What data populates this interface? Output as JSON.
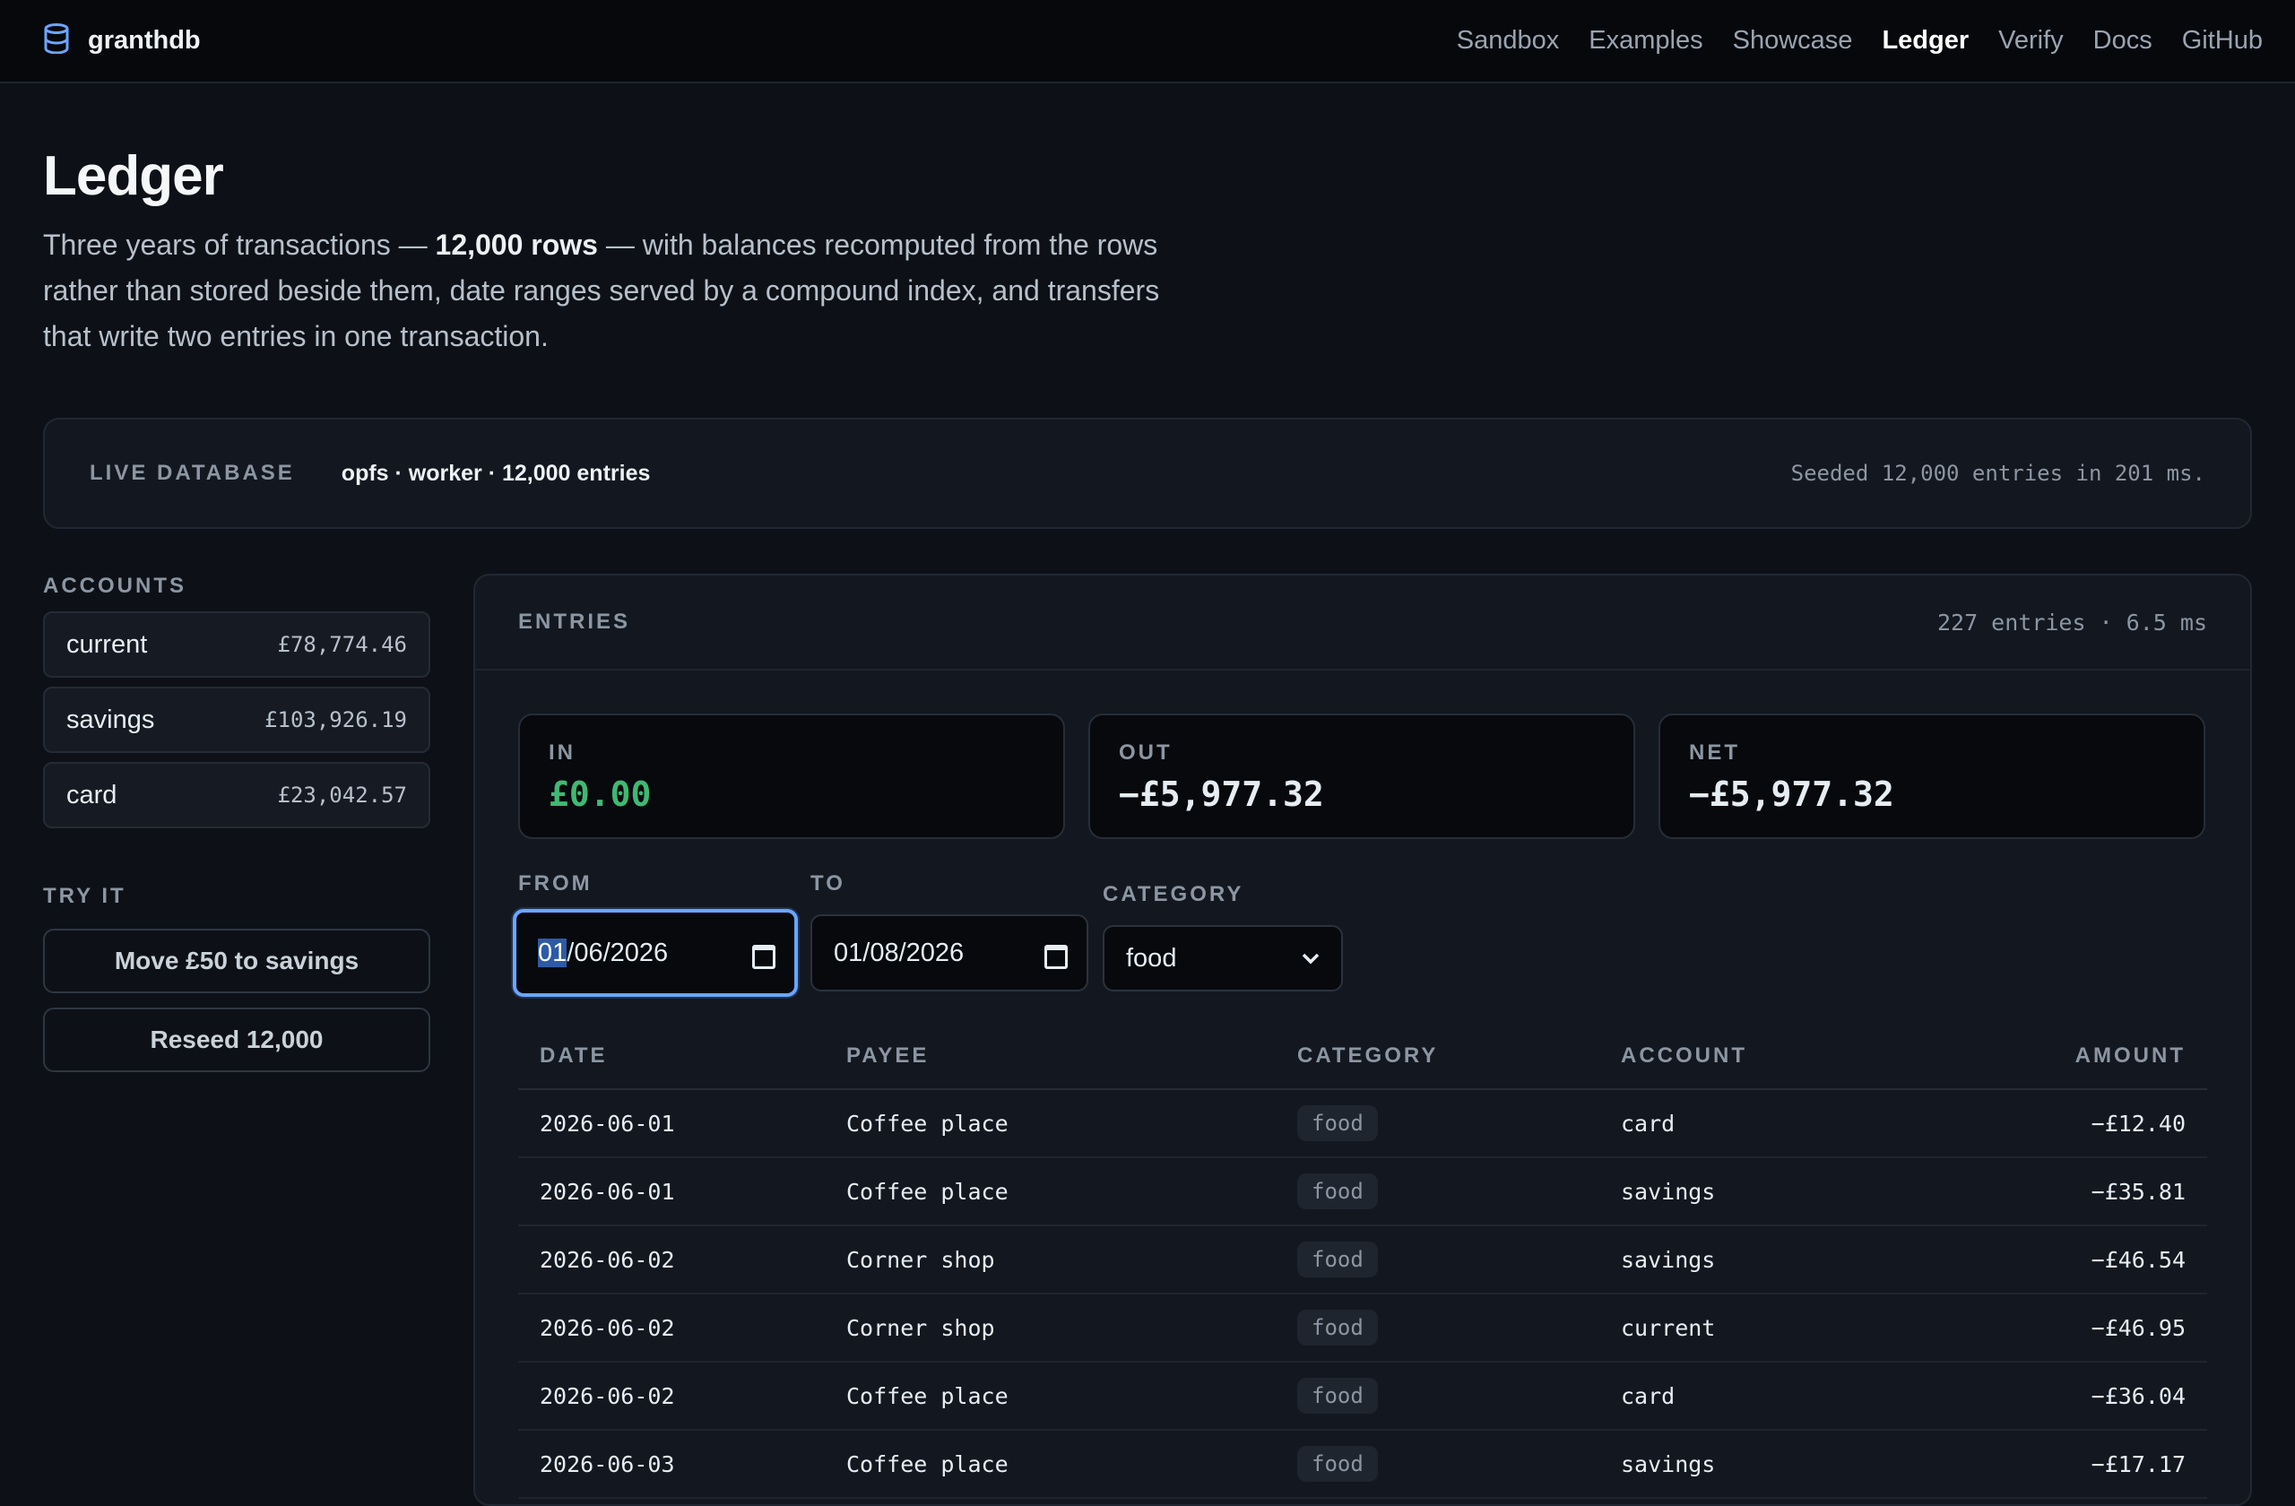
{
  "header": {
    "brand": "granthdb",
    "nav": [
      {
        "label": "Sandbox",
        "active": false
      },
      {
        "label": "Examples",
        "active": false
      },
      {
        "label": "Showcase",
        "active": false
      },
      {
        "label": "Ledger",
        "active": true
      },
      {
        "label": "Verify",
        "active": false
      },
      {
        "label": "Docs",
        "active": false
      },
      {
        "label": "GitHub",
        "active": false
      }
    ]
  },
  "hero": {
    "title": "Ledger",
    "lead_before": "Three years of transactions — ",
    "lead_bold": "12,000 rows",
    "lead_after": " — with balances recomputed from the rows rather than stored beside them, date ranges served by a compound index, and transfers that write two entries in one transaction."
  },
  "live": {
    "label": "LIVE DATABASE",
    "meta": "opfs · worker · 12,000 entries",
    "status": "Seeded 12,000 entries in 201 ms."
  },
  "sidebar": {
    "accounts_label": "ACCOUNTS",
    "accounts": [
      {
        "name": "current",
        "balance": "£78,774.46"
      },
      {
        "name": "savings",
        "balance": "£103,926.19"
      },
      {
        "name": "card",
        "balance": "£23,042.57"
      }
    ],
    "try_label": "TRY IT",
    "buttons": {
      "move": "Move £50 to savings",
      "reseed": "Reseed 12,000"
    }
  },
  "entries": {
    "label": "ENTRIES",
    "summary": "227 entries · 6.5 ms",
    "stats": {
      "in_label": "IN",
      "in_value": "£0.00",
      "out_label": "OUT",
      "out_value": "−£5,977.32",
      "net_label": "NET",
      "net_value": "−£5,977.32"
    },
    "filters": {
      "from_label": "FROM",
      "from_value_sel": "01",
      "from_value_rest": "/06/2026",
      "to_label": "TO",
      "to_value": "01/08/2026",
      "category_label": "CATEGORY",
      "category_value": "food"
    },
    "columns": {
      "date": "DATE",
      "payee": "PAYEE",
      "category": "CATEGORY",
      "account": "ACCOUNT",
      "amount": "AMOUNT"
    },
    "rows": [
      {
        "date": "2026-06-01",
        "payee": "Coffee place",
        "category": "food",
        "account": "card",
        "amount": "−£12.40"
      },
      {
        "date": "2026-06-01",
        "payee": "Coffee place",
        "category": "food",
        "account": "savings",
        "amount": "−£35.81"
      },
      {
        "date": "2026-06-02",
        "payee": "Corner shop",
        "category": "food",
        "account": "savings",
        "amount": "−£46.54"
      },
      {
        "date": "2026-06-02",
        "payee": "Corner shop",
        "category": "food",
        "account": "current",
        "amount": "−£46.95"
      },
      {
        "date": "2026-06-02",
        "payee": "Coffee place",
        "category": "food",
        "account": "card",
        "amount": "−£36.04"
      },
      {
        "date": "2026-06-03",
        "payee": "Coffee place",
        "category": "food",
        "account": "savings",
        "amount": "−£17.17"
      }
    ]
  },
  "colors": {
    "background": "#0d1117",
    "accent": "#6aa6ff",
    "positive": "#3fb972"
  }
}
